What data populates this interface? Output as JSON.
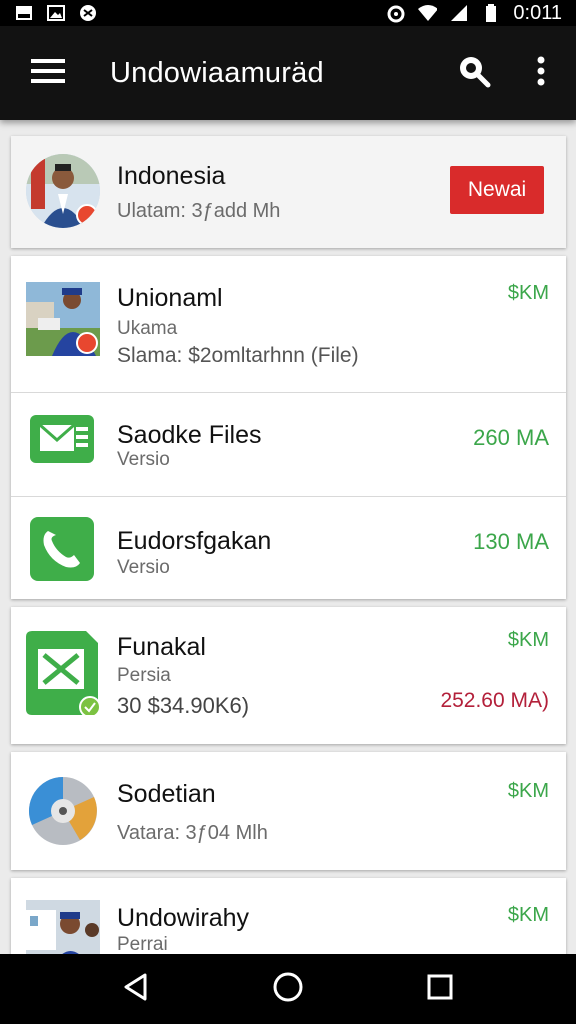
{
  "status_bar": {
    "time": "0:011",
    "left_icons": [
      "notification-icon",
      "image-icon",
      "android-icon"
    ],
    "right_icons": [
      "alarm-icon",
      "wifi-icon",
      "signal-icon",
      "battery-icon"
    ]
  },
  "app_bar": {
    "title": "Undowiaamuräd",
    "icons": [
      "menu-icon",
      "search-icon",
      "more-vert-icon"
    ]
  },
  "featured": {
    "title": "Indonesia",
    "subtitle": "Ulatam: 3ƒadd Mh",
    "button_label": "Newai",
    "button_color": "#d92b2b"
  },
  "list": [
    {
      "title": "Unionaml",
      "subtitle": "Ukama",
      "detail": "Slama: $2omltarhnn (File)",
      "meta": "$KM",
      "icon": "photo-thumbnail"
    },
    {
      "title": "Saodke Files",
      "subtitle": "Versio",
      "meta": "260 MA",
      "icon": "green-mail-icon"
    },
    {
      "title": "Eudorsfgakan",
      "subtitle": "Versio",
      "meta": "130 MA",
      "icon": "green-phone-icon"
    }
  ],
  "card3": {
    "title": "Funakal",
    "subtitle": "Persia",
    "detail": "30 $34.90K6)",
    "meta": "$KM",
    "meta_secondary": "252.60 MA)",
    "icon": "green-sheet-icon"
  },
  "card4": {
    "title": "Sodetian",
    "subtitle": "Vatara: 3ƒ04 Mlh",
    "meta": "$KM",
    "icon": "disc-icon"
  },
  "card5": {
    "title": "Undowirahy",
    "subtitle": "Perrai",
    "meta": "$KM",
    "icon": "photo-thumbnail"
  },
  "colors": {
    "accent_green": "#3ba64a",
    "accent_red": "#d92b2b",
    "app_bar": "#121212"
  },
  "nav_bar": {
    "icons": [
      "back-icon",
      "home-icon",
      "recents-icon"
    ]
  }
}
